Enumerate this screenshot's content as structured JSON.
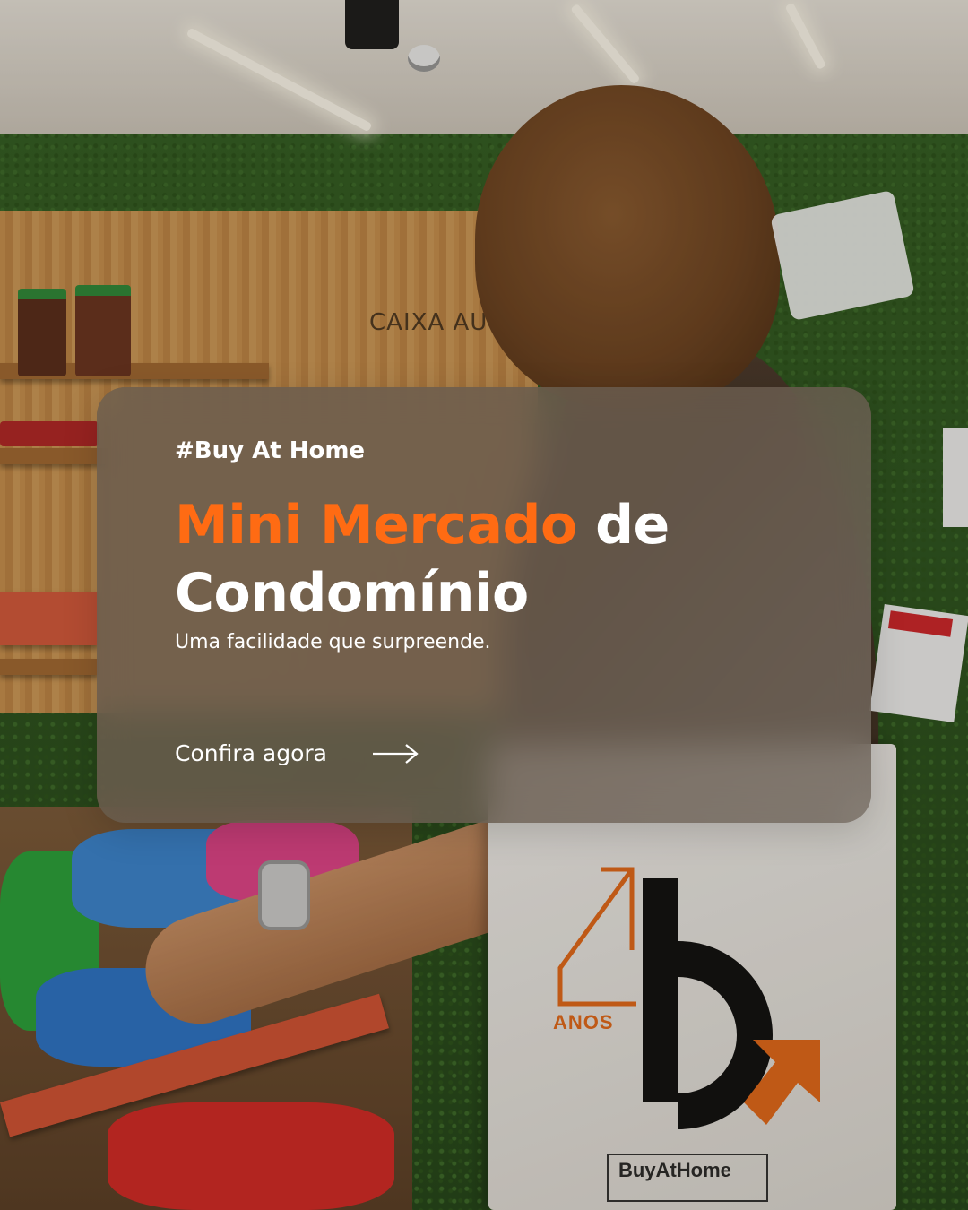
{
  "card": {
    "hashtag": "#Buy At Home",
    "title_accent": "Mini Mercado",
    "title_rest_1": "de",
    "title_rest_2": "Condomínio",
    "subtitle": "Uma facilidade que surpreende.",
    "cta_label": "Confira agora",
    "cta_icon": "arrow-right-icon"
  },
  "photo": {
    "wall_sign": "CAIXA AUTOA",
    "bag_anos": "ANOS",
    "bag_brand": "BuyAtHome"
  },
  "colors": {
    "accent": "#ff6b13",
    "text": "#ffffff"
  }
}
